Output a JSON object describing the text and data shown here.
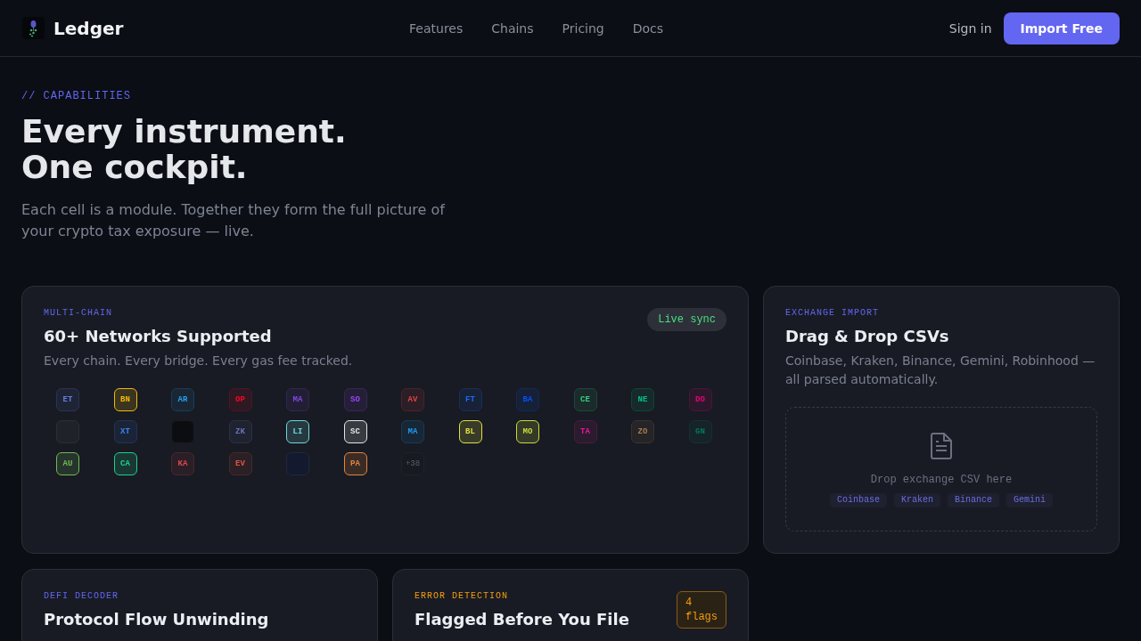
{
  "nav": {
    "brand": "Ledger",
    "links": [
      "Features",
      "Chains",
      "Pricing",
      "Docs"
    ],
    "sign_in": "Sign in",
    "cta": "Import Free"
  },
  "hero": {
    "eyebrow": "// CAPABILITIES",
    "title_lines": [
      "Every instrument.",
      "One cockpit."
    ],
    "description": "Each cell is a module. Together they form the full picture of your crypto tax exposure — live."
  },
  "cards": [
    {
      "kind": "chains",
      "label": "MULTI-CHAIN",
      "color": "#6366f1",
      "title": "60+ Networks Supported",
      "description": "Every chain. Every bridge. Every gas fee tracked.",
      "badge": "Live sync",
      "chains": [
        {
          "kind": "chain",
          "label": "ET",
          "color": "#627eea",
          "highlighted": false
        },
        {
          "kind": "chain",
          "label": "BN",
          "color": "#f0b90b",
          "highlighted": true
        },
        {
          "kind": "chain",
          "label": "AR",
          "color": "#28a0f0",
          "highlighted": false
        },
        {
          "kind": "chain",
          "label": "OP",
          "color": "#ff0420",
          "highlighted": false
        },
        {
          "kind": "chain",
          "label": "MA",
          "color": "#8247e5",
          "highlighted": false
        },
        {
          "kind": "chain",
          "label": "SO",
          "color": "#9945ff",
          "highlighted": false
        },
        {
          "kind": "chain",
          "label": "AV",
          "color": "#e84142",
          "highlighted": false
        },
        {
          "kind": "chain",
          "label": "FT",
          "color": "#1969ff",
          "highlighted": false
        },
        {
          "kind": "chain",
          "label": "BA",
          "color": "#0052ff",
          "highlighted": false
        },
        {
          "kind": "chain",
          "label": "CE",
          "color": "#35d07f",
          "highlighted": false
        },
        {
          "kind": "chain",
          "label": "NE",
          "color": "#00c08b",
          "highlighted": false
        },
        {
          "kind": "chain",
          "label": "DO",
          "color": "#e6007a",
          "highlighted": false
        },
        {
          "kind": "faded",
          "color": "#1f2229"
        },
        {
          "kind": "chain",
          "label": "XT",
          "color": "#3b82f6",
          "highlighted": false
        },
        {
          "kind": "faded",
          "color": "#0c0d11"
        },
        {
          "kind": "chain",
          "label": "ZK",
          "color": "#6b6fb8",
          "highlighted": false
        },
        {
          "kind": "chain",
          "label": "LI",
          "color": "#6fd6d6",
          "highlighted": true
        },
        {
          "kind": "chain",
          "label": "SC",
          "color": "#e5e5e5",
          "highlighted": true
        },
        {
          "kind": "chain",
          "label": "MA",
          "color": "#1d9bf0",
          "highlighted": false
        },
        {
          "kind": "chain",
          "label": "BL",
          "color": "#e0e040",
          "highlighted": true
        },
        {
          "kind": "chain",
          "label": "MO",
          "color": "#c8dc3c",
          "highlighted": true
        },
        {
          "kind": "chain",
          "label": "TA",
          "color": "#e81899",
          "highlighted": false
        },
        {
          "kind": "chain",
          "label": "ZO",
          "color": "#a97c50",
          "highlighted": false
        },
        {
          "kind": "chain",
          "label": "GN",
          "color": "#04795b",
          "highlighted": false
        },
        {
          "kind": "chain",
          "label": "AU",
          "color": "#70b85a",
          "highlighted": true
        },
        {
          "kind": "chain",
          "label": "CA",
          "color": "#1fcf8f",
          "highlighted": true
        },
        {
          "kind": "chain",
          "label": "KA",
          "color": "#e0474c",
          "highlighted": false
        },
        {
          "kind": "chain",
          "label": "EV",
          "color": "#e0553f",
          "highlighted": false
        },
        {
          "kind": "faded",
          "color": "#131a30"
        },
        {
          "kind": "chain",
          "label": "PA",
          "color": "#e8833a",
          "highlighted": true
        },
        {
          "kind": "more",
          "label": "+38"
        }
      ]
    },
    {
      "kind": "import",
      "label": "EXCHANGE IMPORT",
      "color": "#6366f1",
      "title": "Drag & Drop CSVs",
      "description": "Coinbase, Kraken, Binance, Gemini, Robinhood — all parsed automatically.",
      "drop_text": "Drop exchange CSV here",
      "exchanges": [
        "Coinbase",
        "Kraken",
        "Binance",
        "Gemini"
      ]
    },
    {
      "kind": "basic",
      "label": "DEFI DECODER",
      "color": "#6366f1",
      "title": "Protocol Flow Unwinding"
    },
    {
      "kind": "flags",
      "label": "ERROR DETECTION",
      "color": "#f59e0b",
      "title": "Flagged Before You File",
      "badge": "4 flags"
    }
  ]
}
